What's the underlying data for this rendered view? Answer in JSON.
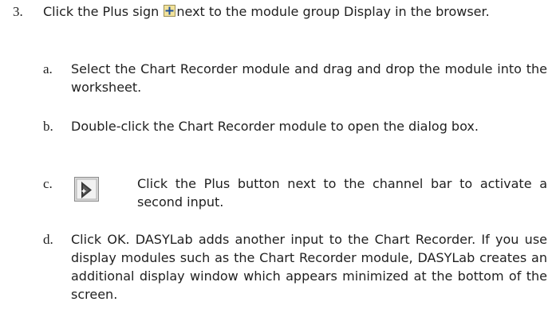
{
  "step": {
    "number": "3.",
    "text_before_icon": "Click the Plus sign ",
    "text_after_icon": "next to the module group Display in the browser.",
    "plus_sign_icon": "plus-sign-icon"
  },
  "substeps": [
    {
      "letter": "a.",
      "text": "Select the Chart Recorder module and drag and drop the module into the worksheet."
    },
    {
      "letter": "b.",
      "text": "Double-click the Chart Recorder module to open the dialog box."
    },
    {
      "letter": "c.",
      "text": "Click the Plus button next to the channel bar to activate a second input.",
      "icon": "plus-button-icon"
    },
    {
      "letter": "d.",
      "text": "Click OK. DASYLab adds another input to the Chart Recorder. If you use display modules such as the Chart Recorder module, DASYLab creates an additional display window which appears minimized at the bottom of the screen."
    }
  ],
  "colors": {
    "text": "#1f1f1f",
    "icon_yellow": "#f3e39a",
    "icon_blue": "#1f4f9a"
  }
}
